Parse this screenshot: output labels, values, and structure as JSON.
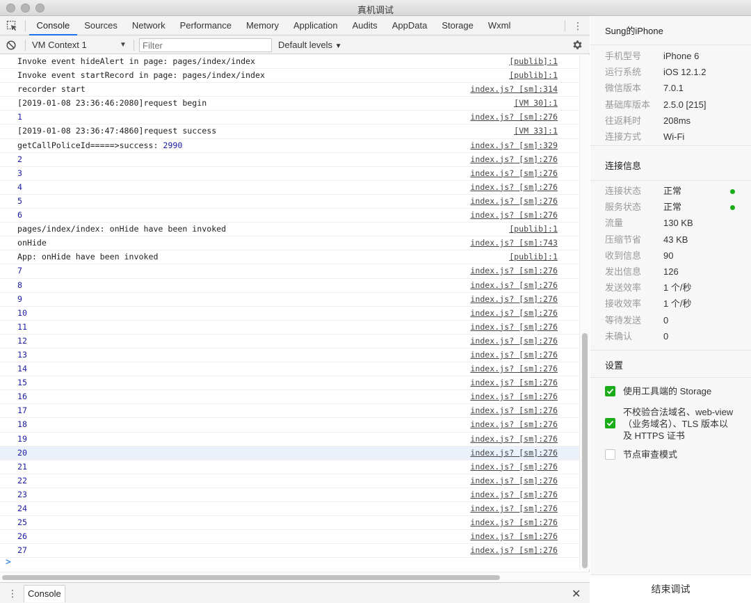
{
  "window": {
    "title": "真机调试"
  },
  "tabs": [
    "Console",
    "Sources",
    "Network",
    "Performance",
    "Memory",
    "Application",
    "Audits",
    "AppData",
    "Storage",
    "Wxml"
  ],
  "active_tab": "Console",
  "filterbar": {
    "context": "VM Context 1",
    "filter_placeholder": "Filter",
    "levels": "Default levels"
  },
  "log": [
    {
      "msg": "Invoke event hideAlert in page: pages/index/index",
      "src": "[publib]:1",
      "num": false
    },
    {
      "msg": "Invoke event startRecord in page: pages/index/index",
      "src": "[publib]:1",
      "num": false
    },
    {
      "msg": "recorder start",
      "src": "index.js? [sm]:314",
      "num": false
    },
    {
      "msg": "[2019-01-08 23:36:46:2080]request begin",
      "src": "[VM 30]:1",
      "num": false
    },
    {
      "msg": "1",
      "src": "index.js? [sm]:276",
      "num": true
    },
    {
      "msg": "[2019-01-08 23:36:47:4860]request success",
      "src": "[VM 33]:1",
      "num": false
    },
    {
      "msg": "getCallPoliceId=====>success: ",
      "val": "2990",
      "src": "index.js? [sm]:329",
      "num": false
    },
    {
      "msg": "2",
      "src": "index.js? [sm]:276",
      "num": true
    },
    {
      "msg": "3",
      "src": "index.js? [sm]:276",
      "num": true
    },
    {
      "msg": "4",
      "src": "index.js? [sm]:276",
      "num": true
    },
    {
      "msg": "5",
      "src": "index.js? [sm]:276",
      "num": true
    },
    {
      "msg": "6",
      "src": "index.js? [sm]:276",
      "num": true
    },
    {
      "msg": "pages/index/index: onHide have been invoked",
      "src": "[publib]:1",
      "num": false
    },
    {
      "msg": "onHide",
      "src": "index.js? [sm]:743",
      "num": false
    },
    {
      "msg": "App: onHide have been invoked",
      "src": "[publib]:1",
      "num": false
    },
    {
      "msg": "7",
      "src": "index.js? [sm]:276",
      "num": true
    },
    {
      "msg": "8",
      "src": "index.js? [sm]:276",
      "num": true
    },
    {
      "msg": "9",
      "src": "index.js? [sm]:276",
      "num": true
    },
    {
      "msg": "10",
      "src": "index.js? [sm]:276",
      "num": true
    },
    {
      "msg": "11",
      "src": "index.js? [sm]:276",
      "num": true
    },
    {
      "msg": "12",
      "src": "index.js? [sm]:276",
      "num": true
    },
    {
      "msg": "13",
      "src": "index.js? [sm]:276",
      "num": true
    },
    {
      "msg": "14",
      "src": "index.js? [sm]:276",
      "num": true
    },
    {
      "msg": "15",
      "src": "index.js? [sm]:276",
      "num": true
    },
    {
      "msg": "16",
      "src": "index.js? [sm]:276",
      "num": true
    },
    {
      "msg": "17",
      "src": "index.js? [sm]:276",
      "num": true
    },
    {
      "msg": "18",
      "src": "index.js? [sm]:276",
      "num": true
    },
    {
      "msg": "19",
      "src": "index.js? [sm]:276",
      "num": true
    },
    {
      "msg": "20",
      "src": "index.js? [sm]:276",
      "num": true,
      "highlight": true
    },
    {
      "msg": "21",
      "src": "index.js? [sm]:276",
      "num": true
    },
    {
      "msg": "22",
      "src": "index.js? [sm]:276",
      "num": true
    },
    {
      "msg": "23",
      "src": "index.js? [sm]:276",
      "num": true
    },
    {
      "msg": "24",
      "src": "index.js? [sm]:276",
      "num": true
    },
    {
      "msg": "25",
      "src": "index.js? [sm]:276",
      "num": true
    },
    {
      "msg": "26",
      "src": "index.js? [sm]:276",
      "num": true
    },
    {
      "msg": "27",
      "src": "index.js? [sm]:276",
      "num": true
    }
  ],
  "prompt": ">",
  "drawer": {
    "tab": "Console"
  },
  "device": {
    "name": "Sung的iPhone",
    "info": [
      {
        "k": "手机型号",
        "v": "iPhone 6"
      },
      {
        "k": "运行系统",
        "v": "iOS 12.1.2"
      },
      {
        "k": "微信版本",
        "v": "7.0.1"
      },
      {
        "k": "基础库版本",
        "v": "2.5.0 [215]"
      },
      {
        "k": "往返耗时",
        "v": "208ms"
      },
      {
        "k": "连接方式",
        "v": "Wi-Fi"
      }
    ]
  },
  "connection": {
    "title": "连接信息",
    "info": [
      {
        "k": "连接状态",
        "v": "正常",
        "dot": true
      },
      {
        "k": "服务状态",
        "v": "正常",
        "dot": true
      },
      {
        "k": "流量",
        "v": "130 KB"
      },
      {
        "k": "压缩节省",
        "v": "43 KB"
      },
      {
        "k": "收到信息",
        "v": "90"
      },
      {
        "k": "发出信息",
        "v": "126"
      },
      {
        "k": "发送效率",
        "v": "1 个/秒"
      },
      {
        "k": "接收效率",
        "v": "1 个/秒"
      },
      {
        "k": "等待发送",
        "v": "0"
      },
      {
        "k": "未确认",
        "v": "0"
      }
    ],
    "status_color": "#1aad19"
  },
  "settings": {
    "title": "设置",
    "options": [
      {
        "label": "使用工具端的 Storage",
        "checked": true
      },
      {
        "label": "不校验合法域名、web-view（业务域名）、TLS 版本以及 HTTPS 证书",
        "checked": true
      },
      {
        "label": "节点审查模式",
        "checked": false
      }
    ]
  },
  "end_button": "结束调试"
}
